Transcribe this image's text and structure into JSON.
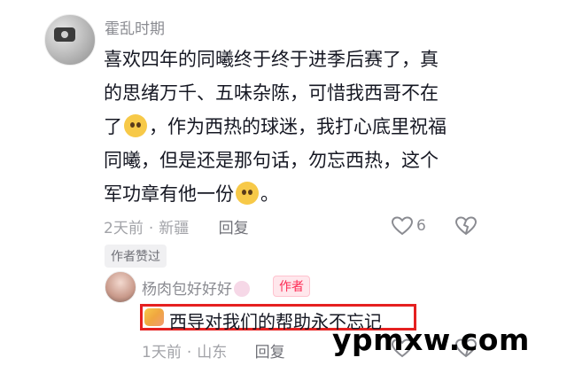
{
  "comment": {
    "username": "霍乱时期",
    "line1": "喜欢四年的同曦终于终于进季后赛了，真",
    "line2": "的思绪万千、五味杂陈，可惜我西哥不在",
    "line3a": "了",
    "line3b": "，作为西热的球迷，我打心底里祝福",
    "line4": "同曦，但是还是那句话，勿忘西热，这个",
    "line5a": "军功章有他一份",
    "line5b": "。",
    "time": "2天前",
    "separator": "·",
    "location": "新疆",
    "reply_label": "回复",
    "like_count": "6",
    "author_liked_label": "作者赞过"
  },
  "reply": {
    "username": "杨肉包好好好",
    "author_badge": "作者",
    "text": "西导对我们的帮助永不忘记",
    "time": "1天前",
    "separator": "·",
    "location": "山东",
    "reply_label": "回复"
  },
  "watermark": "ypmxw.com",
  "colors": {
    "author_badge": "#fe2c55",
    "highlight_box": "#e52020",
    "meta_text": "#a2a3a8"
  },
  "icons": [
    "heart-icon",
    "dislike-heart-icon",
    "pleading-face-emoji",
    "hug-emoji",
    "flower-emoji"
  ]
}
